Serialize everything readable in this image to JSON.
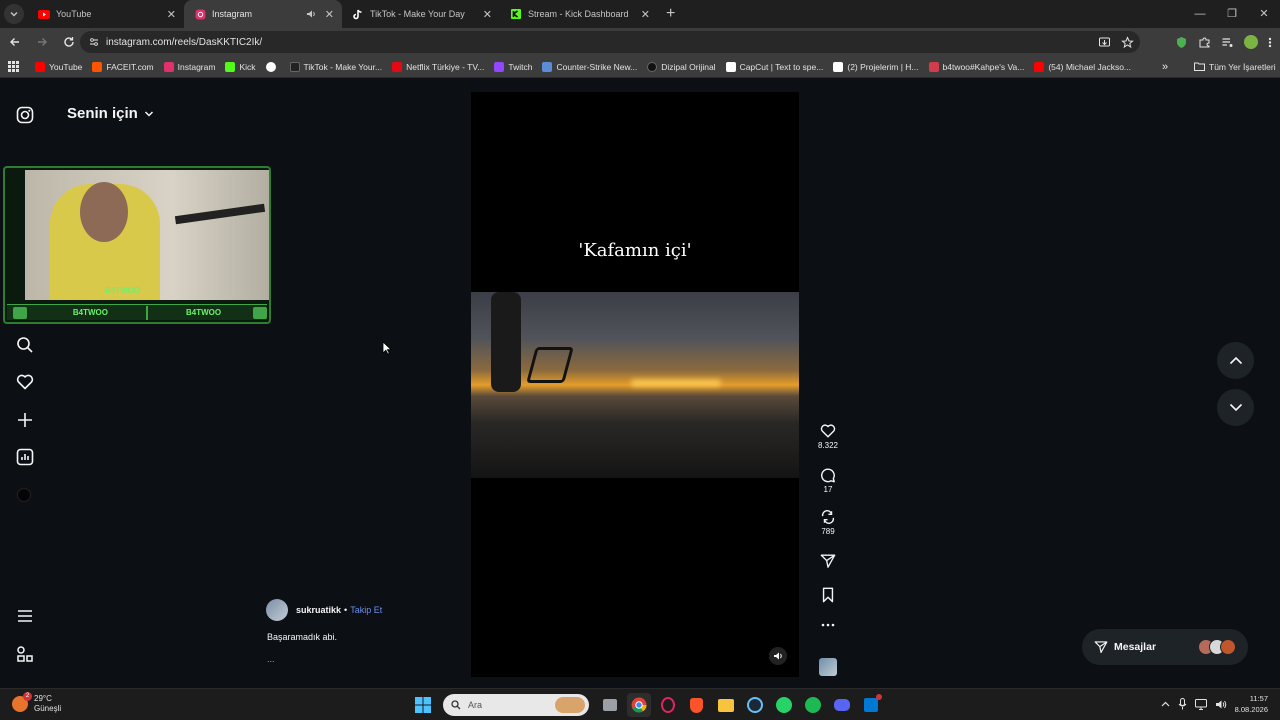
{
  "tabs": [
    {
      "label": "YouTube",
      "color": "#ff0000"
    },
    {
      "label": "Instagram",
      "color": "#e1306c",
      "active": true
    },
    {
      "label": "TikTok - Make Your Day",
      "color": "#ffffff"
    },
    {
      "label": "Stream - Kick Dashboard",
      "color": "#53fc18"
    }
  ],
  "address": {
    "url": "instagram.com/reels/DasKKTIC2Ik/"
  },
  "bookmarks": [
    {
      "label": "YouTube",
      "color": "#ff0000"
    },
    {
      "label": "FACEIT.com",
      "color": "#ff5500"
    },
    {
      "label": "Instagram",
      "color": "#e1306c"
    },
    {
      "label": "Kick",
      "color": "#53fc18"
    },
    {
      "label": "",
      "color": "#ffffff"
    },
    {
      "label": "TikTok - Make Your...",
      "color": "#222222"
    },
    {
      "label": "Netflix Türkiye - TV...",
      "color": "#e50914"
    },
    {
      "label": "Twitch",
      "color": "#9146ff"
    },
    {
      "label": "Counter-Strike New...",
      "color": "#5b8dd6"
    },
    {
      "label": "Dizipal Orijinal",
      "color": "#111111"
    },
    {
      "label": "CapCut | Text to spe...",
      "color": "#ffffff"
    },
    {
      "label": "(2) Projelerim | H...",
      "color": "#ffffff"
    },
    {
      "label": "b4twoo#Kahpe's Va...",
      "color": "#d13b4b"
    },
    {
      "label": "(54) Michael Jackso...",
      "color": "#ff0000"
    }
  ],
  "bookmarks_all": "Tüm Yer İşaretleri",
  "instagram": {
    "section_title": "Senin için",
    "webcam": {
      "name": "B4TWOO",
      "bar_left": "B4TWOO",
      "bar_right": "B4TWOO"
    },
    "reel": {
      "caption": "'Kafamın içi'"
    },
    "actions": {
      "likes": "8.322",
      "comments": "17",
      "reposts": "789"
    },
    "author": {
      "username": "sukruatikk",
      "separator": "•",
      "follow": "Takip Et"
    },
    "description": "Başaramadık abi.",
    "more": "...",
    "messages": "Mesajlar"
  },
  "taskbar": {
    "temperature": "29°C",
    "weather": "Güneşli",
    "weather_badge": "2",
    "search_placeholder": "Ara",
    "time": "11:57",
    "date": "8.08.2026"
  }
}
